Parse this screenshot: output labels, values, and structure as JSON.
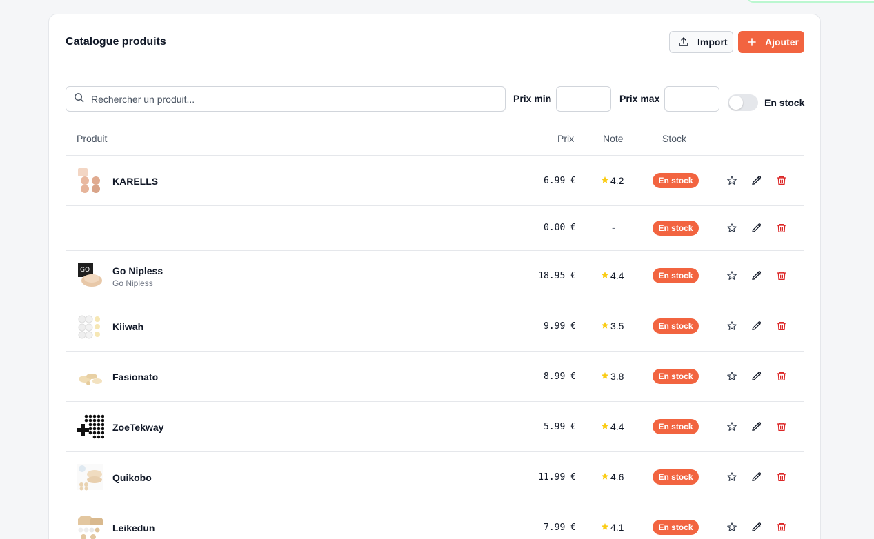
{
  "colors": {
    "accent": "#f26440",
    "danger": "#dc2626",
    "rating_star": "#facc15"
  },
  "header": {
    "title": "Catalogue produits",
    "import_label": "Import",
    "add_label": "Ajouter"
  },
  "filters": {
    "search_placeholder": "Rechercher un produit...",
    "min_price_label": "Prix min",
    "max_price_label": "Prix max",
    "min_price_value": "",
    "max_price_value": "",
    "in_stock_toggle_label": "En stock",
    "in_stock_toggle_on": false
  },
  "table": {
    "columns": {
      "product": "Produit",
      "price": "Prix",
      "rating": "Note",
      "stock": "Stock"
    },
    "rows": [
      {
        "name": "KARELLS",
        "subtitle": "",
        "price": "6.99 €",
        "rating": "4.2",
        "stock": "En stock",
        "thumb": "karells"
      },
      {
        "name": "",
        "subtitle": "",
        "price": "0.00 €",
        "rating": "-",
        "stock": "En stock",
        "thumb": ""
      },
      {
        "name": "Go Nipless",
        "subtitle": "Go Nipless",
        "price": "18.95 €",
        "rating": "4.4",
        "stock": "En stock",
        "thumb": "gonipless"
      },
      {
        "name": "Kiiwah",
        "subtitle": "",
        "price": "9.99 €",
        "rating": "3.5",
        "stock": "En stock",
        "thumb": "kiiwah"
      },
      {
        "name": "Fasionato",
        "subtitle": "",
        "price": "8.99 €",
        "rating": "3.8",
        "stock": "En stock",
        "thumb": "fasionato"
      },
      {
        "name": "ZoeTekway",
        "subtitle": "",
        "price": "5.99 €",
        "rating": "4.4",
        "stock": "En stock",
        "thumb": "zoetekway"
      },
      {
        "name": "Quikobo",
        "subtitle": "",
        "price": "11.99 €",
        "rating": "4.6",
        "stock": "En stock",
        "thumb": "quikobo"
      },
      {
        "name": "Leikedun",
        "subtitle": "",
        "price": "7.99 €",
        "rating": "4.1",
        "stock": "En stock",
        "thumb": "leikedun"
      }
    ]
  },
  "icons": {
    "import": "upload-icon",
    "add": "plus-icon",
    "search": "search-icon",
    "favorite": "star-outline-icon",
    "edit": "pencil-icon",
    "delete": "trash-icon",
    "rating": "star-filled-icon"
  }
}
